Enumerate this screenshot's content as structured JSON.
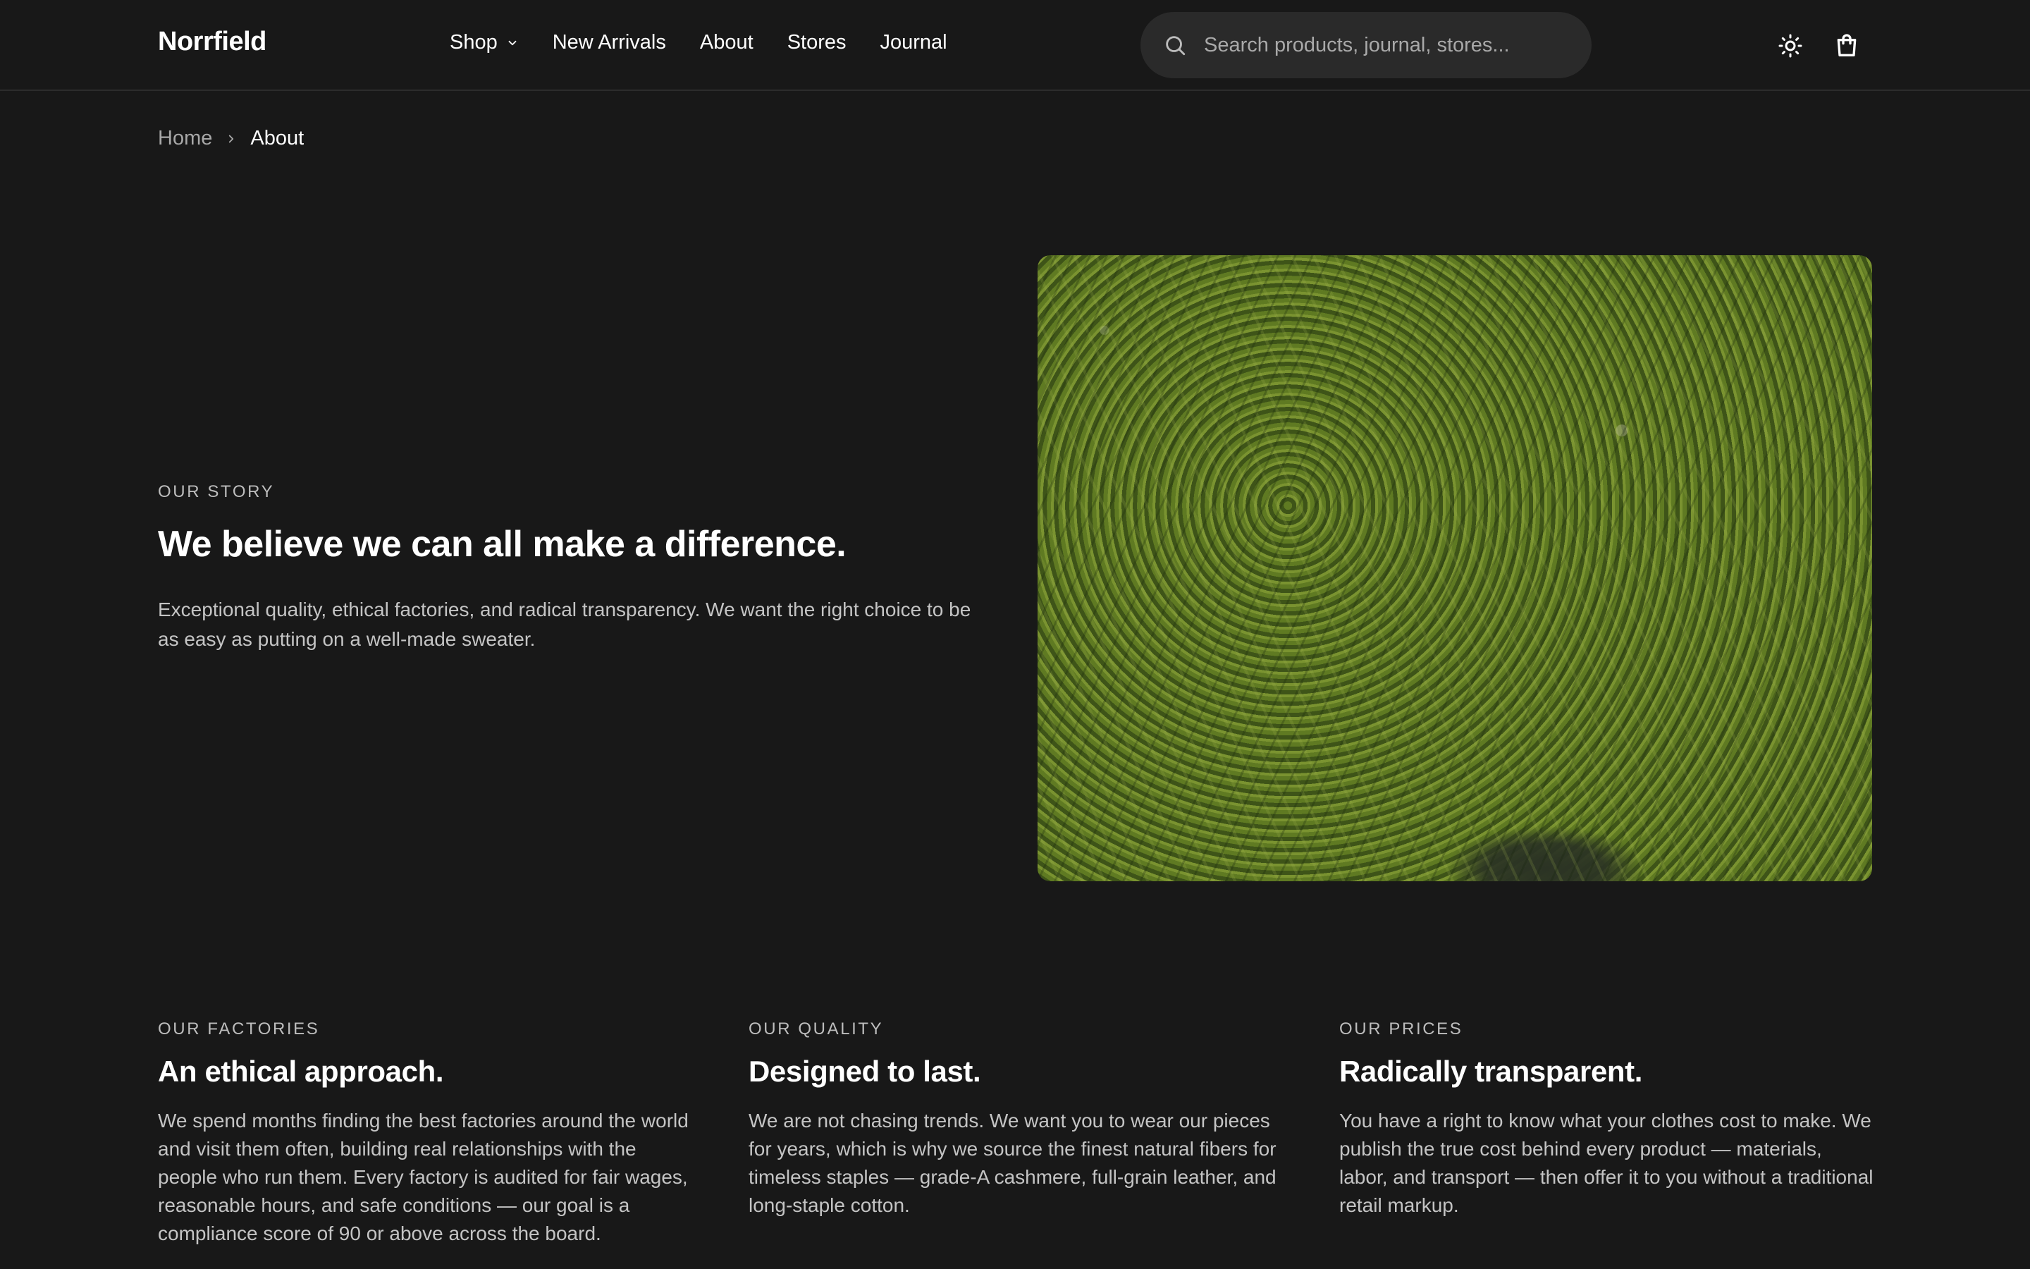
{
  "header": {
    "brand": "Norrfield",
    "nav": {
      "shop": "Shop",
      "new_arrivals": "New Arrivals",
      "about": "About",
      "stores": "Stores",
      "journal": "Journal"
    },
    "search": {
      "placeholder": "Search products, journal, stores..."
    },
    "icons": [
      "search-icon",
      "sun-icon",
      "shopping-bag-icon",
      "chevron-down-icon"
    ]
  },
  "breadcrumb": {
    "home": "Home",
    "current": "About"
  },
  "hero": {
    "eyebrow": "OUR STORY",
    "title": "We believe we can all make a difference.",
    "body": "Exceptional quality, ethical factories, and radical transparency. We want the right choice to be as easy as putting on a well-made sweater."
  },
  "values": [
    {
      "eyebrow": "OUR FACTORIES",
      "title": "An ethical approach.",
      "body": "We spend months finding the best factories around the world and visit them often, building real relationships with the people who run them. Every factory is audited for fair wages, reasonable hours, and safe conditions — our goal is a compliance score of 90 or above across the board."
    },
    {
      "eyebrow": "OUR QUALITY",
      "title": "Designed to last.",
      "body": "We are not chasing trends. We want you to wear our pieces for years, which is why we source the finest natural fibers for timeless staples — grade-A cashmere, full-grain leather, and long-staple cotton."
    },
    {
      "eyebrow": "OUR PRICES",
      "title": "Radically transparent.",
      "body": "You have a right to know what your clothes cost to make. We publish the true cost behind every product — materials, labor, and transport — then offer it to you without a traditional retail markup."
    }
  ],
  "colors": {
    "background": "#181818",
    "search_bg": "#2a2a2a",
    "text": "#ffffff",
    "muted_text": "#c4c4c4"
  }
}
